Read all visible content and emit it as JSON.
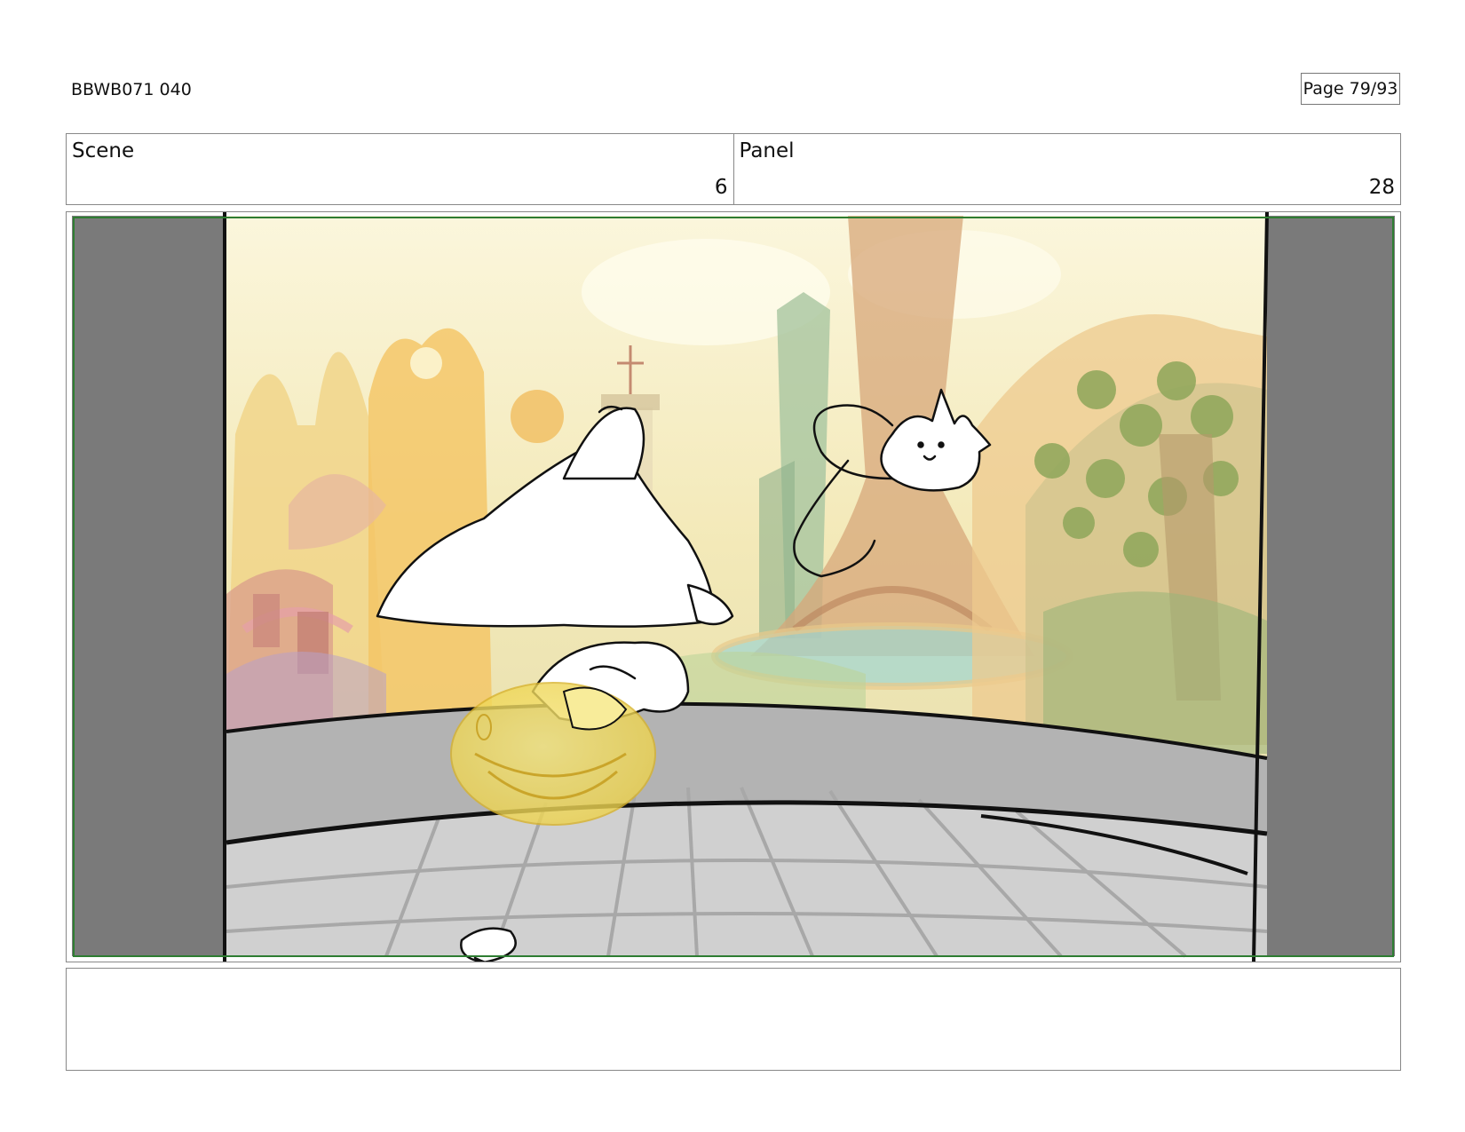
{
  "header": {
    "doc_id": "BBWB071 040",
    "page_label": "Page 79/93"
  },
  "info": {
    "scene_label": "Scene",
    "scene_value": "6",
    "panel_label": "Panel",
    "panel_value": "28"
  },
  "notes": {
    "text": ""
  },
  "colors": {
    "frame_border": "#2e7d32",
    "letterbox": "#7a7a7a",
    "bubble": "#f3dc55"
  }
}
